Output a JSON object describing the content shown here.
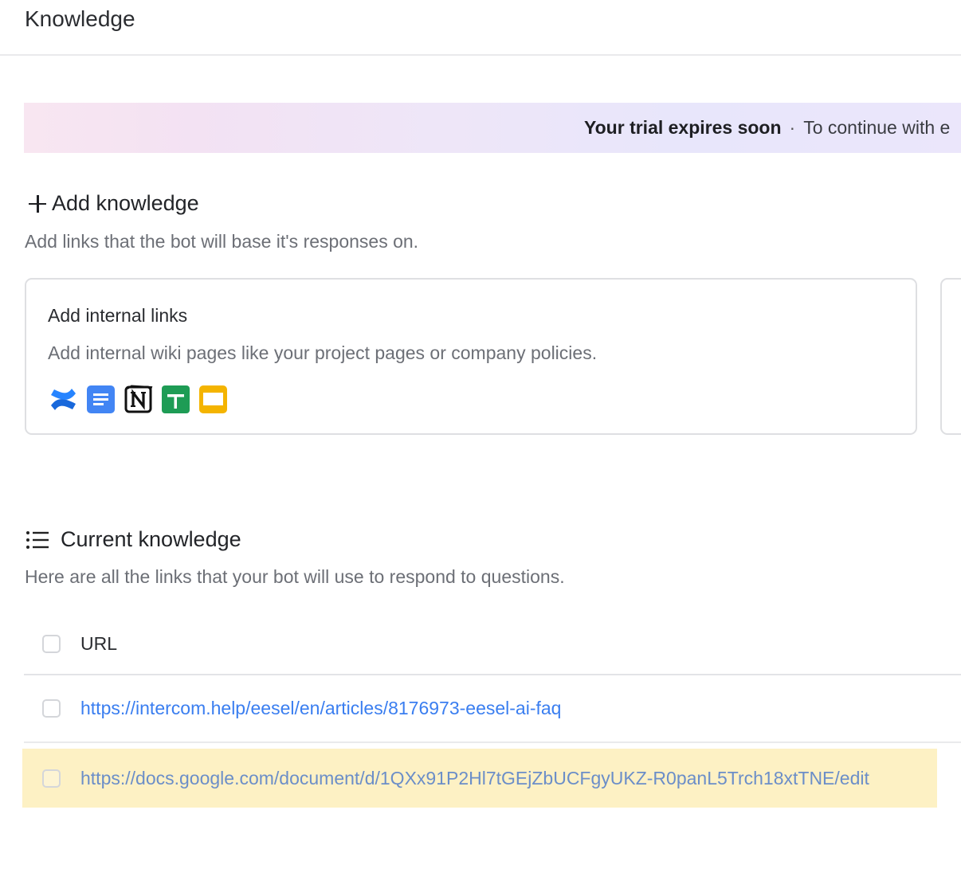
{
  "header": {
    "title": "Knowledge"
  },
  "banner": {
    "strong": "Your trial expires soon",
    "separator": "·",
    "text": "To continue with e"
  },
  "add_knowledge": {
    "heading": "Add knowledge",
    "subtitle": "Add links that the bot will base it's responses on.",
    "card": {
      "title": "Add internal links",
      "description": "Add internal wiki pages like your project pages or company policies.",
      "icons": [
        "confluence-icon",
        "google-docs-icon",
        "notion-icon",
        "google-sheets-icon",
        "google-slides-icon"
      ]
    }
  },
  "current_knowledge": {
    "heading": "Current knowledge",
    "subtitle": "Here are all the links that your bot will use to respond to questions.",
    "table": {
      "column_header": "URL",
      "rows": [
        {
          "url": "https://intercom.help/eesel/en/articles/8176973-eesel-ai-faq",
          "highlighted": false
        },
        {
          "url": "https://docs.google.com/document/d/1QXx91P2Hl7tGEjZbUCFgyUKZ-R0panL5Trch18xtTNE/edit",
          "highlighted": true
        }
      ]
    }
  },
  "colors": {
    "link": "#3a7ef0",
    "highlight_row": "#fdf1c4",
    "banner_start": "#f8e6f1",
    "banner_end": "#ebe6fb"
  }
}
